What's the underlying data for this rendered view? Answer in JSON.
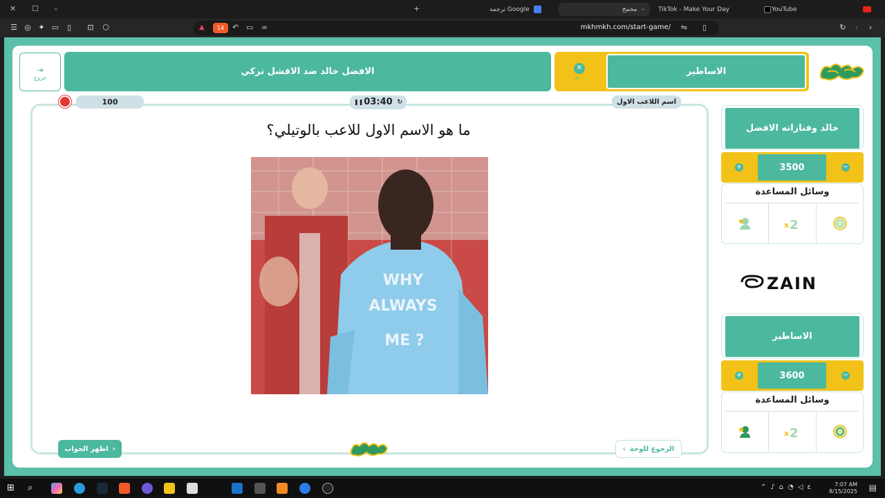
{
  "browser": {
    "tabs": [
      {
        "label": "YouTube"
      },
      {
        "label": "TikTok - Make Your Day"
      },
      {
        "label": "مخمخ"
      },
      {
        "label": "ترجمة Google"
      }
    ],
    "shield_count": "14",
    "url": "mkhmkh.com/start-game/"
  },
  "header": {
    "exit_label": "خروج",
    "category": "الافضل خالد ضد الافشل تركي",
    "current_team": "الاساطير",
    "turn_label": "ش"
  },
  "question_panel": {
    "category_tag": "اسم اللاعب الاول",
    "timer": "03:40",
    "points": "100",
    "question": "ما هو الاسم الاول للاعب بالوتيلي؟",
    "shirt_text_line1": "WHY",
    "shirt_text_line2": "ALWAYS",
    "shirt_text_line3": "ME ?",
    "reveal_label": "اظهر الجواب",
    "back_label": "الرجوع للوحة"
  },
  "teams": [
    {
      "name": "خالد وفنازاته الافضل",
      "score": "3500",
      "help_title": "وسائل المساعدة"
    },
    {
      "name": "الاساطير",
      "score": "3600",
      "help_title": "وسائل المساعدة"
    }
  ],
  "sponsor": "ZAIN",
  "help_icons": [
    "call-friend-icon",
    "double-points-icon",
    "skip-question-icon"
  ],
  "clock": {
    "time": "7:07 AM",
    "date": "8/15/2025"
  },
  "colors": {
    "teal": "#4cb89e",
    "yellow": "#f2c218",
    "flag": "#e53935"
  }
}
